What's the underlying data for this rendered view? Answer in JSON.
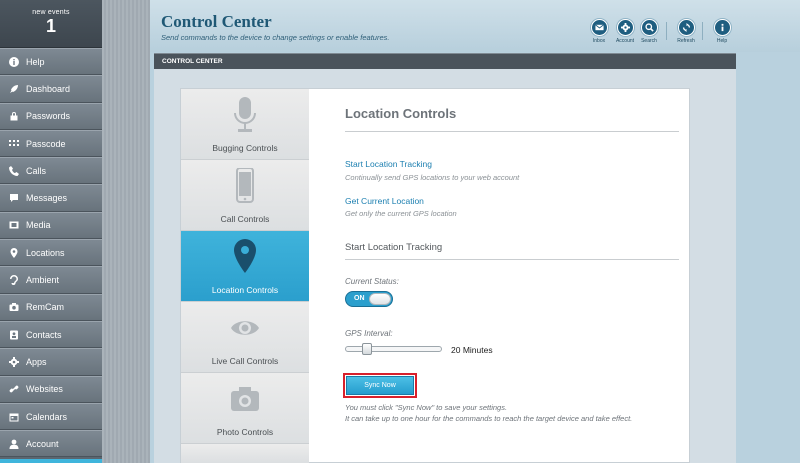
{
  "sidebar": {
    "events_label": "new events",
    "events_count": "1",
    "items": [
      {
        "label": "Help",
        "icon": "info-icon"
      },
      {
        "label": "Dashboard",
        "icon": "rocket-icon"
      },
      {
        "label": "Passwords",
        "icon": "lock-icon"
      },
      {
        "label": "Passcode",
        "icon": "keypad-icon"
      },
      {
        "label": "Calls",
        "icon": "phone-icon"
      },
      {
        "label": "Messages",
        "icon": "chat-icon"
      },
      {
        "label": "Media",
        "icon": "film-icon"
      },
      {
        "label": "Locations",
        "icon": "map-pin-icon"
      },
      {
        "label": "Ambient",
        "icon": "ear-icon"
      },
      {
        "label": "RemCam",
        "icon": "camera-icon"
      },
      {
        "label": "Contacts",
        "icon": "contacts-icon"
      },
      {
        "label": "Apps",
        "icon": "gear-icon"
      },
      {
        "label": "Websites",
        "icon": "link-icon"
      },
      {
        "label": "Calendars",
        "icon": "calendar-icon"
      },
      {
        "label": "Account",
        "icon": "user-icon"
      }
    ]
  },
  "header": {
    "title": "Control Center",
    "subtitle": "Send commands to the device to change settings or enable features.",
    "buttons": [
      {
        "label": "Inbox",
        "icon": "envelope-icon"
      },
      {
        "label": "Account",
        "icon": "gear-icon"
      },
      {
        "label": "Search",
        "icon": "search-icon"
      },
      {
        "label": "Refresh",
        "icon": "refresh-icon"
      },
      {
        "label": "Help",
        "icon": "info-icon"
      }
    ]
  },
  "section": {
    "title": "CONTROL CENTER"
  },
  "tabs": [
    {
      "label": "Bugging Controls",
      "icon": "microphone-icon"
    },
    {
      "label": "Call Controls",
      "icon": "phone-device-icon"
    },
    {
      "label": "Location Controls",
      "icon": "map-pin-icon",
      "active": true
    },
    {
      "label": "Live Call Controls",
      "icon": "eye-icon"
    },
    {
      "label": "Photo Controls",
      "icon": "camera-icon"
    }
  ],
  "main": {
    "title": "Location Controls",
    "link1": "Start Location Tracking",
    "desc1": "Continually send GPS locations to your web account",
    "link2": "Get Current Location",
    "desc2": "Get only the current GPS location",
    "subsection_title": "Start Location Tracking",
    "status_label": "Current Status:",
    "toggle_label": "ON",
    "interval_label": "GPS Interval:",
    "interval_value": "20 Minutes",
    "interval_fraction": 0.2,
    "sync_label": "Sync Now",
    "note1": "You must click \"Sync Now\" to save your settings.",
    "note2": "It can take up to one hour for the commands to reach the target device and take effect."
  },
  "colors": {
    "accent": "#2b9fcd",
    "sidebar": "#6d7880",
    "highlight_outline": "#d8202b"
  }
}
